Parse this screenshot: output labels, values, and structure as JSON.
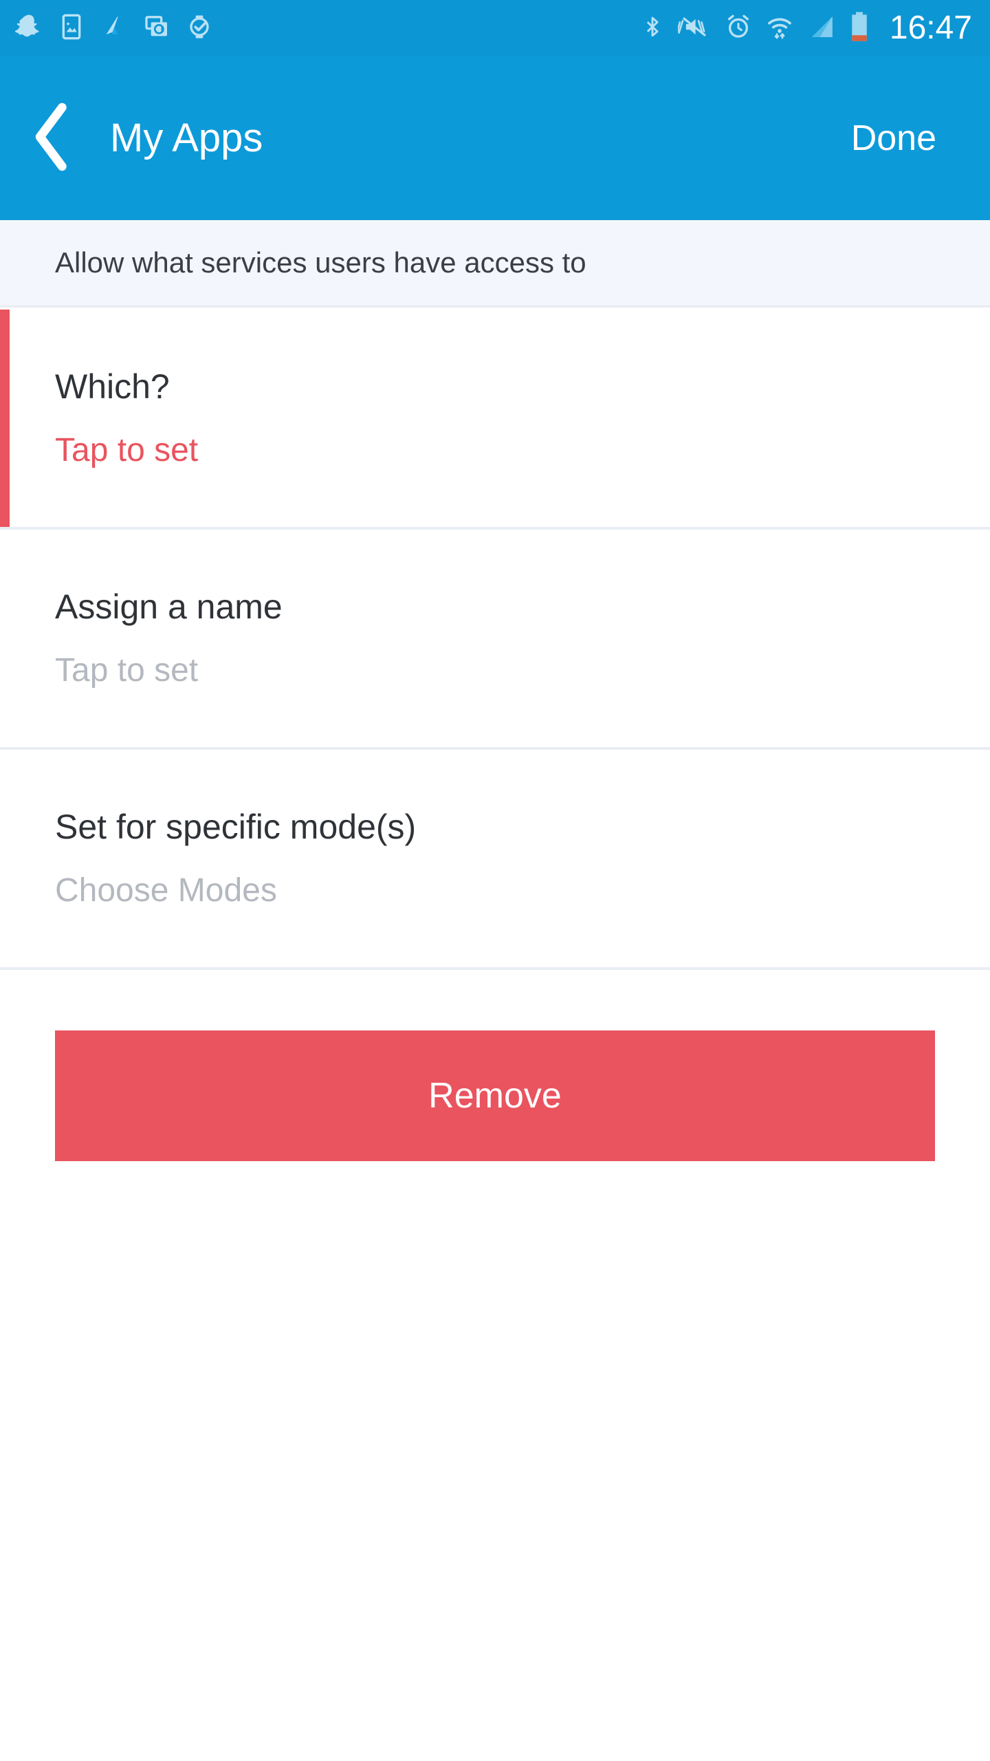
{
  "status_bar": {
    "time": "16:47",
    "background_color": "#0d96d4",
    "notification_icons": [
      {
        "name": "snapchat-icon",
        "label": "Snapchat"
      },
      {
        "name": "screenshot-icon",
        "label": "Screenshot saved"
      },
      {
        "name": "app-logo-icon",
        "label": "App"
      },
      {
        "name": "email-cards-icon",
        "label": "Email"
      },
      {
        "name": "smartwatch-check-icon",
        "label": "Watch connected"
      }
    ],
    "system_icons": [
      {
        "name": "bluetooth-icon",
        "label": "Bluetooth"
      },
      {
        "name": "vibrate-mute-icon",
        "label": "Vibrate"
      },
      {
        "name": "alarm-icon",
        "label": "Alarm set"
      },
      {
        "name": "wifi-icon",
        "label": "Wi-Fi"
      },
      {
        "name": "cellular-signal-icon",
        "label": "Signal"
      },
      {
        "name": "battery-low-icon",
        "label": "Battery low"
      }
    ]
  },
  "app_bar": {
    "back_label": "Back",
    "title": "My Apps",
    "done_label": "Done",
    "background_color": "#0d9ad9"
  },
  "banner": {
    "text": "Allow what services users have access to",
    "background_color": "#f3f6fc"
  },
  "rows": [
    {
      "title": "Which?",
      "value": "Tap to set",
      "state": "required",
      "accent_color": "#e9545f",
      "has_accent_bar": true
    },
    {
      "title": "Assign a name",
      "value": "Tap to set",
      "state": "empty",
      "has_accent_bar": false
    },
    {
      "title": "Set for specific mode(s)",
      "value": "Choose Modes",
      "state": "empty",
      "has_accent_bar": false
    }
  ],
  "remove_button": {
    "label": "Remove",
    "background_color": "#e9545f",
    "text_color": "#ffffff"
  }
}
